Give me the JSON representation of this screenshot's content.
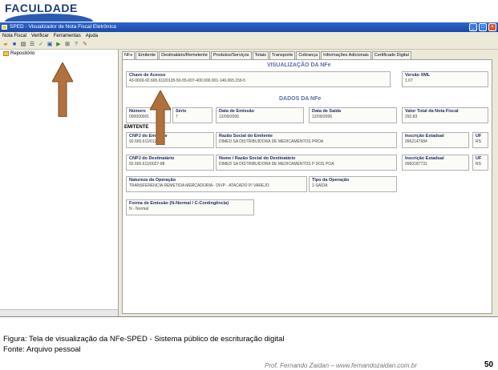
{
  "slide": {
    "logo_text": "FACULDADE",
    "figure_caption": "Figura: Tela de visualização da NFe-SPED - Sistema público de escrituração digital",
    "source_caption": "Fonte: Arquivo pessoal",
    "footer": "Prof. Fernando Zaidan – www.fernandozaidan.com.br",
    "page_number": "50"
  },
  "window": {
    "title": "SPED - Visualizador de Nota Fiscal Eletrônica",
    "menu": [
      "Nota Fiscal",
      "Verificar",
      "Ferramentas",
      "Ajuda"
    ],
    "toolbar_icons": [
      "open-icon",
      "save-icon",
      "print-icon",
      "list-icon",
      "check-icon",
      "verify-icon",
      "export-icon",
      "zoom-icon",
      "help-icon",
      "info-icon"
    ]
  },
  "tree": {
    "root_label": "Repositório"
  },
  "tabs": [
    "NFe",
    "Emitente",
    "Destinatário/Remetente",
    "Produtos/Serviços",
    "Totais",
    "Transporte",
    "Cobrança",
    "Informações Adicionais",
    "Certificado Digital"
  ],
  "nfe": {
    "section1_title": "VISUALIZAÇÃO DA NFe",
    "chave_label": "Chave de Acesso",
    "chave_value": "43-0609-92.665.611/0128-50-55-007-400.000.001-146.065.159-5",
    "versao_label": "Versão XML",
    "versao_value": "1.07",
    "section2_title": "DADOS DA NFe",
    "numero_label": "Número",
    "numero_value": "000000001",
    "serie_label": "Série",
    "serie_value": "7",
    "data_emissao_label": "Data de Emissão",
    "data_emissao_value": "12/09/2006",
    "data_saida_label": "Data de Saída",
    "data_saida_value": "12/09/2006",
    "valor_label": "Valor Total da Nota Fiscal",
    "valor_value": "292,83",
    "emitente_label": "EMITENTE",
    "cnpj_emit_label": "CNPJ do Emitente",
    "cnpj_emit_value": "92.665.611/0128-50",
    "razao_emit_label": "Razão Social do Emitente",
    "razao_emit_value": "DIMED SA DISTRIBUIDORA DE MEDICAMENTOS PROA",
    "ie_emit_label": "Inscrição Estadual",
    "ie_emit_value": "0962147684",
    "uf_emit_label": "UF",
    "uf_emit_value": "RS",
    "cnpj_dest_label": "CNPJ do Destinatário",
    "cnpj_dest_value": "92.665.611/0027-88",
    "razao_dest_label": "Nome / Razão Social do Destinatário",
    "razao_dest_value": "DIMED SA DISTRIBUIDORA DE MEDICAMENTOS P DOS POA",
    "ie_dest_label": "Inscrição Estadual",
    "ie_dest_value": "0960187731",
    "uf_dest_label": "UF",
    "uf_dest_value": "RS",
    "natureza_label": "Natureza da Operação",
    "natureza_value": "TRANSFERENCIA REMETIDA MERCADORIA - DIVP - ATACADO P/ VAREJO",
    "tipo_label": "Tipo da Operação",
    "tipo_value": "1-SAÍDA",
    "forma_label": "Forma de Emissão (N-Normal / C-Contingência)",
    "forma_value": "N - Normal"
  },
  "colors": {
    "section_title": "#5a6fa8",
    "titlebar": "#2d66cc",
    "arrow": "#b0713f"
  }
}
